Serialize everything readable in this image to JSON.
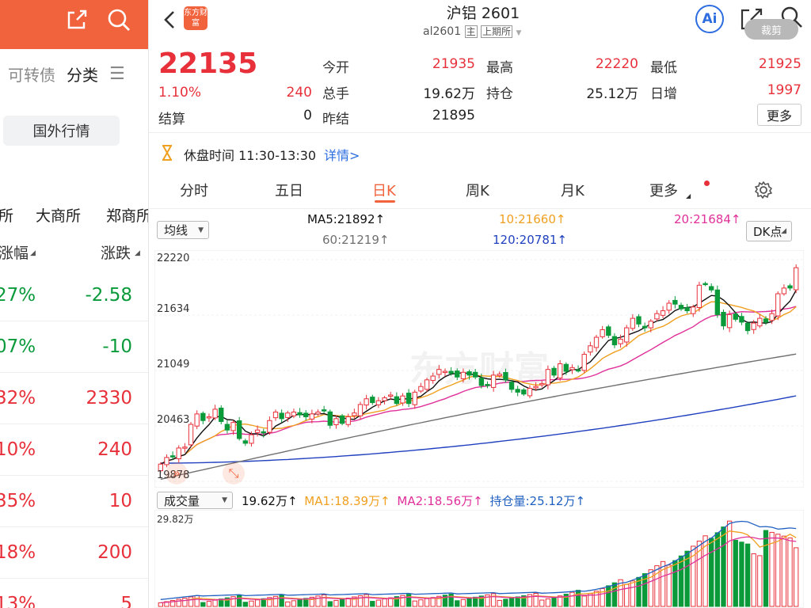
{
  "left_panel": {
    "tabs": [
      "可转债",
      "分类"
    ],
    "foreign_button": "国外行情",
    "exchanges": [
      "所",
      "大商所",
      "郑商所"
    ],
    "col_headers": [
      "涨幅",
      "涨跌"
    ],
    "rows": [
      {
        "pct": "27%",
        "chg": "-2.58",
        "color": "green"
      },
      {
        "pct": "07%",
        "chg": "-10",
        "color": "green"
      },
      {
        "pct": "32%",
        "chg": "2330",
        "color": "red"
      },
      {
        "pct": "10%",
        "chg": "240",
        "color": "red"
      },
      {
        "pct": "35%",
        "chg": "10",
        "color": "red"
      },
      {
        "pct": "18%",
        "chg": "200",
        "color": "red"
      },
      {
        "pct": "13%",
        "chg": "5",
        "color": "red"
      }
    ]
  },
  "header": {
    "logo_text": "东方财富",
    "title": "沪铝 2601",
    "code": "al2601",
    "tag_main": "主",
    "tag_exchange": "上期所",
    "ai_label": "Ai",
    "clip_label": "裁剪"
  },
  "quote": {
    "price": "22135",
    "change_pct": "1.10%",
    "change": "240",
    "settle_label": "结算",
    "settle": "0",
    "open_label": "今开",
    "open": "21935",
    "volume_label": "总手",
    "volume": "19.62万",
    "prev_label": "昨结",
    "prev": "21895",
    "high_label": "最高",
    "high": "22220",
    "oi_label": "持仓",
    "oi": "25.12万",
    "low_label": "最低",
    "low": "21925",
    "daily_inc_label": "日增",
    "daily_inc": "1997",
    "more_label": "更多"
  },
  "session": {
    "text": "休盘时间 11:30-13:30",
    "link": "详情>"
  },
  "tabs": [
    "分时",
    "五日",
    "日K",
    "周K",
    "月K",
    "更多"
  ],
  "active_tab": "日K",
  "ma_bar": {
    "dropdown": "均线",
    "ma5": "MA5:21892↑",
    "ma10": "10:21660↑",
    "ma20": "20:21684↑",
    "ma60": "60:21219↑",
    "ma120": "120:20781↑",
    "dk": "DK点"
  },
  "price_axis": [
    "22220",
    "21634",
    "21049",
    "20463",
    "19878"
  ],
  "watermark": "东方财富",
  "vol_bar": {
    "dropdown": "成交量",
    "vol": "19.62万↑",
    "ma1": "MA1:18.39万↑",
    "ma2": "MA2:18.56万↑",
    "oi": "持仓量:25.12万↑",
    "axis_max": "29.82万"
  },
  "colors": {
    "up": "#e8303a",
    "down": "#0a9a3a",
    "ma5": "#111111",
    "ma10": "#f0a020",
    "ma20": "#e0309a",
    "ma60": "#707070",
    "ma120": "#2040c0",
    "accent": "#f1633d"
  },
  "chart_data": {
    "type": "candlestick",
    "ylim": [
      19878,
      22220
    ],
    "closes": [
      20060,
      20130,
      20140,
      20230,
      20240,
      20480,
      20590,
      20520,
      20560,
      20640,
      20510,
      20420,
      20500,
      20330,
      20280,
      20370,
      20420,
      20390,
      20520,
      20610,
      20540,
      20600,
      20610,
      20580,
      20560,
      20590,
      20610,
      20630,
      20470,
      20540,
      20490,
      20560,
      20600,
      20690,
      20750,
      20710,
      20730,
      20760,
      20790,
      20700,
      20780,
      20700,
      20820,
      20880,
      20950,
      20990,
      21060,
      21040,
      21020,
      20980,
      21030,
      21000,
      20980,
      20890,
      20900,
      21000,
      21010,
      20950,
      20850,
      20820,
      20800,
      20860,
      20880,
      20910,
      21060,
      21000,
      21120,
      21040,
      21080,
      21050,
      21220,
      21310,
      21400,
      21480,
      21420,
      21320,
      21380,
      21500,
      21600,
      21540,
      21500,
      21570,
      21650,
      21680,
      21760,
      21750,
      21700,
      21680,
      21720,
      21950,
      21960,
      21900,
      21640,
      21520,
      21640,
      21590,
      21560,
      21470,
      21550,
      21600,
      21560,
      21650,
      21860,
      21920,
      21920,
      22135
    ],
    "ma5_last": 21892,
    "ma10_last": 21660,
    "ma20_last": 21684,
    "ma60_last": 21219,
    "ma120_last": 20781,
    "volume_max": "29.82万"
  }
}
